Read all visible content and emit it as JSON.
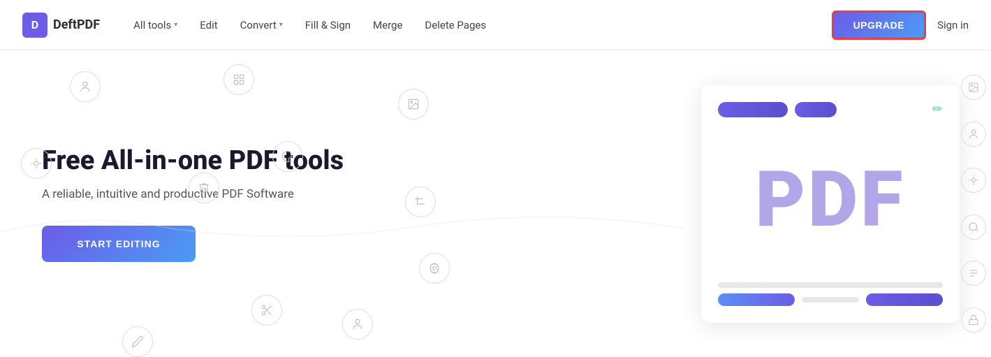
{
  "nav": {
    "logo_letter": "D",
    "logo_name": "DeftPDF",
    "links": [
      {
        "label": "All tools",
        "has_dropdown": true,
        "id": "all-tools"
      },
      {
        "label": "Edit",
        "has_dropdown": false,
        "id": "edit"
      },
      {
        "label": "Convert",
        "has_dropdown": true,
        "id": "convert"
      },
      {
        "label": "Fill & Sign",
        "has_dropdown": false,
        "id": "fill-sign"
      },
      {
        "label": "Merge",
        "has_dropdown": false,
        "id": "merge"
      },
      {
        "label": "Delete Pages",
        "has_dropdown": false,
        "id": "delete-pages"
      }
    ],
    "upgrade_label": "UPGRADE",
    "signin_label": "Sign in"
  },
  "hero": {
    "title": "Free All-in-one PDF tools",
    "subtitle": "A reliable, intuitive and productive PDF Software",
    "cta_label": "START EDITING"
  },
  "preview_card": {
    "pdf_text": "PDF"
  },
  "colors": {
    "brand_purple": "#6c5ce7",
    "brand_blue": "#4b9cf5",
    "upgrade_border": "#e84040",
    "edit_teal": "#6bc5a0"
  }
}
